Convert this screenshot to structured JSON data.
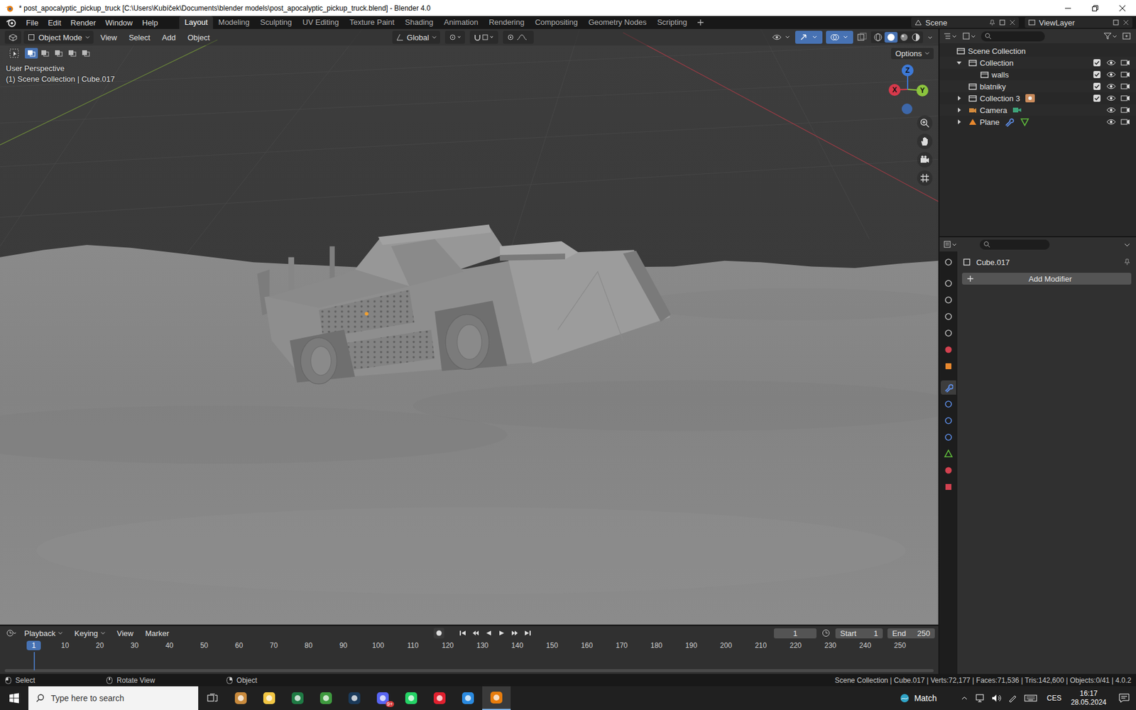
{
  "window": {
    "title": "* post_apocalyptic_pickup_truck [C:\\Users\\Kubíček\\Documents\\blender models\\post_apocalyptic_pickup_truck.blend] - Blender 4.0"
  },
  "menu": [
    "File",
    "Edit",
    "Render",
    "Window",
    "Help"
  ],
  "workspaces": [
    {
      "label": "Layout",
      "selected": true
    },
    {
      "label": "Modeling",
      "selected": false
    },
    {
      "label": "Sculpting",
      "selected": false
    },
    {
      "label": "UV Editing",
      "selected": false
    },
    {
      "label": "Texture Paint",
      "selected": false
    },
    {
      "label": "Shading",
      "selected": false
    },
    {
      "label": "Animation",
      "selected": false
    },
    {
      "label": "Rendering",
      "selected": false
    },
    {
      "label": "Compositing",
      "selected": false
    },
    {
      "label": "Geometry Nodes",
      "selected": false
    },
    {
      "label": "Scripting",
      "selected": false
    }
  ],
  "scene": "Scene",
  "view_layer": "ViewLayer",
  "viewport": {
    "mode": "Object Mode",
    "menus": [
      "View",
      "Select",
      "Add",
      "Object"
    ],
    "orientation": "Global",
    "options": "Options",
    "perspective": "User Perspective",
    "context": "(1) Scene Collection | Cube.017",
    "axes": [
      {
        "label": "X",
        "color": "#d6394b"
      },
      {
        "label": "Y",
        "color": "#8cc43e"
      },
      {
        "label": "Z",
        "color": "#3d79d7"
      }
    ],
    "select_modes": [
      {
        "selected": true
      },
      {
        "selected": false
      },
      {
        "selected": false
      },
      {
        "selected": false
      },
      {
        "selected": false
      }
    ]
  },
  "outliner": {
    "root": {
      "label": "Scene Collection",
      "kind": "scene",
      "expandable": false,
      "expanded": true,
      "extras": [],
      "children": [
        {
          "label": "Collection",
          "kind": "collection",
          "expandable": true,
          "expanded": true,
          "checked": true,
          "visible": true,
          "renderable": true,
          "extras": [],
          "children": [
            {
              "label": "walls",
              "kind": "collection",
              "expandable": false,
              "expanded": false,
              "checked": true,
              "visible": true,
              "renderable": true,
              "extras": [],
              "children": []
            }
          ]
        },
        {
          "label": "blatniky",
          "kind": "collection",
          "expandable": false,
          "expanded": false,
          "checked": true,
          "visible": true,
          "renderable": true,
          "extras": [],
          "children": []
        },
        {
          "label": "Collection 3",
          "kind": "collection",
          "expandable": true,
          "expanded": false,
          "checked": true,
          "visible": true,
          "renderable": true,
          "extras": [
            "objects"
          ],
          "children": []
        },
        {
          "label": "Camera",
          "kind": "camera",
          "expandable": true,
          "expanded": false,
          "visible": true,
          "renderable": true,
          "extras": [
            "camera_data"
          ],
          "children": []
        },
        {
          "label": "Plane",
          "kind": "mesh",
          "expandable": true,
          "expanded": false,
          "visible": true,
          "renderable": true,
          "extras": [
            "modifier",
            "mesh_data"
          ],
          "children": []
        }
      ]
    }
  },
  "properties": {
    "object": "Cube.017",
    "add_modifier": "Add Modifier",
    "tabs": [
      {
        "kind": "tool",
        "color": "#b8b8b8",
        "selected": false
      },
      {
        "kind": "render",
        "color": "#b8b8b8",
        "selected": false
      },
      {
        "kind": "output",
        "color": "#b8b8b8",
        "selected": false
      },
      {
        "kind": "view_layer",
        "color": "#b8b8b8",
        "selected": false
      },
      {
        "kind": "scene",
        "color": "#b8b8b8",
        "selected": false
      },
      {
        "kind": "world",
        "color": "#d2414f",
        "selected": false
      },
      {
        "kind": "object",
        "color": "#e8882e",
        "selected": false
      },
      {
        "kind": "modifiers",
        "color": "#5e8ee8",
        "selected": true
      },
      {
        "kind": "particles",
        "color": "#5e8ee8",
        "selected": false
      },
      {
        "kind": "physics",
        "color": "#5e8ee8",
        "selected": false
      },
      {
        "kind": "constraints",
        "color": "#5e8ee8",
        "selected": false
      },
      {
        "kind": "data",
        "color": "#5fbb3c",
        "selected": false
      },
      {
        "kind": "material",
        "color": "#d2414f",
        "selected": false
      },
      {
        "kind": "texture",
        "color": "#d2414f",
        "selected": false
      }
    ]
  },
  "timeline": {
    "menus": [
      {
        "label": "Playback",
        "kind": "dropdown"
      },
      {
        "label": "Keying",
        "kind": "dropdown"
      },
      {
        "label": "View",
        "kind": "plain"
      },
      {
        "label": "Marker",
        "kind": "plain"
      }
    ],
    "current_frame": "1",
    "start_label": "Start",
    "start": "1",
    "end_label": "End",
    "end": "250",
    "ticks": [
      "10",
      "20",
      "30",
      "40",
      "50",
      "60",
      "70",
      "80",
      "90",
      "100",
      "110",
      "120",
      "130",
      "140",
      "150",
      "160",
      "170",
      "180",
      "190",
      "200",
      "210",
      "220",
      "230",
      "240",
      "250"
    ]
  },
  "status_bar": {
    "hints": [
      "Select",
      "Rotate View",
      "Object"
    ],
    "stats": "Scene Collection | Cube.017 | Verts:72,177 | Faces:71,536 | Tris:142,600 | Objects:0/41 | 4.0.2"
  },
  "taskbar": {
    "search_placeholder": "Type here to search",
    "apps": [
      {
        "color": "#c98a3c",
        "selected": false,
        "badge": ""
      },
      {
        "color": "#f3c744",
        "selected": false,
        "badge": ""
      },
      {
        "color": "#1f7a44",
        "selected": false,
        "badge": ""
      },
      {
        "color": "#3f9a3f",
        "selected": false,
        "badge": ""
      },
      {
        "color": "#1b3a5a",
        "selected": false,
        "badge": ""
      },
      {
        "color": "#5865f2",
        "selected": false,
        "badge": "9+"
      },
      {
        "color": "#25d366",
        "selected": false,
        "badge": ""
      },
      {
        "color": "#e0202e",
        "selected": false,
        "badge": ""
      },
      {
        "color": "#2a8ae0",
        "selected": false,
        "badge": ""
      },
      {
        "color": "#e87d0d",
        "selected": true,
        "badge": ""
      }
    ],
    "weather": "Match",
    "language": "CES",
    "time": "16:17",
    "date": "28.05.2024"
  }
}
